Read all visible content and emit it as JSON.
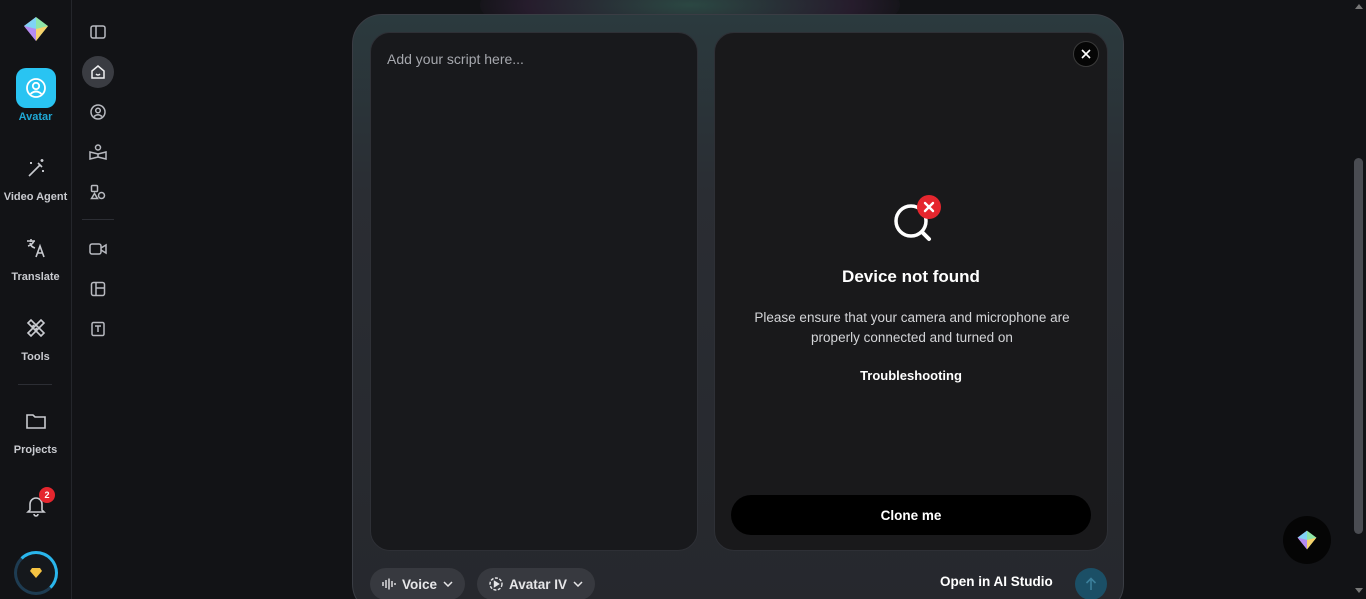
{
  "nav": {
    "items": [
      {
        "key": "avatar",
        "label": "Avatar",
        "icon": "avatar-icon",
        "active": true
      },
      {
        "key": "video-agent",
        "label": "Video Agent",
        "icon": "magic-wand-icon"
      },
      {
        "key": "translate",
        "label": "Translate",
        "icon": "translate-icon"
      },
      {
        "key": "tools",
        "label": "Tools",
        "icon": "tools-icon"
      },
      {
        "key": "projects",
        "label": "Projects",
        "icon": "folder-icon"
      }
    ],
    "notifications_count": "2"
  },
  "subnav": {
    "icons": [
      "sidebar-toggle-icon",
      "home-icon",
      "user-circle-icon",
      "book-icon",
      "shapes-icon",
      "video-camera-icon",
      "layout-icon",
      "template-icon"
    ]
  },
  "script": {
    "placeholder": "Add your script here..."
  },
  "camera": {
    "title": "Device not found",
    "description": "Please ensure that your camera and microphone are properly connected and turned on",
    "link": "Troubleshooting",
    "clone_label": "Clone me"
  },
  "toolbar": {
    "voice_label": "Voice",
    "avatar_model_label": "Avatar IV",
    "open_studio_label": "Open in AI Studio"
  },
  "colors": {
    "accent": "#29c4f2",
    "error": "#e5262e",
    "background": "#121316"
  }
}
